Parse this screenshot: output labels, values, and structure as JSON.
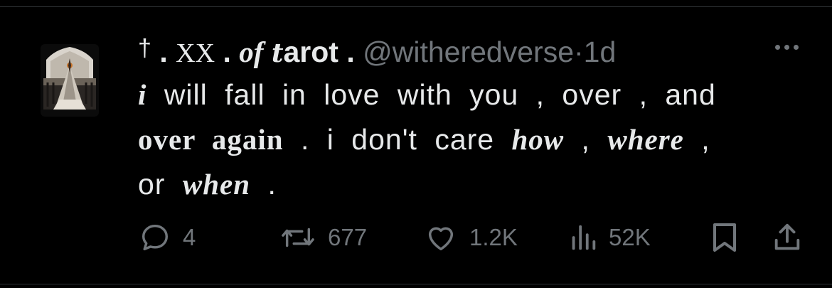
{
  "tweet": {
    "author": {
      "name_parts": {
        "cross": "†",
        "dot1": ".",
        "roman": "XX",
        "dot2": ".",
        "of": "of",
        "t": "t",
        "arot": "arot",
        "dot3": "."
      },
      "handle": "@witheredverse",
      "separator": "·",
      "time": "1d"
    },
    "body": {
      "l1_em": "i",
      "l1_rest": "will fall in love with you , over , and",
      "l2_em": "over again",
      "l2_mid": ". i don't care",
      "l2_how": "how",
      "l2_comma": ",",
      "l2_where": "where",
      "l2_end": ",",
      "l3_start": "or",
      "l3_when": "when",
      "l3_end": "."
    },
    "actions": {
      "replies": "4",
      "retweets": "677",
      "likes": "1.2K",
      "views": "52K"
    }
  },
  "icons": [
    "reply-icon",
    "retweet-icon",
    "like-icon",
    "views-icon",
    "bookmark-icon",
    "share-icon",
    "more-icon"
  ]
}
